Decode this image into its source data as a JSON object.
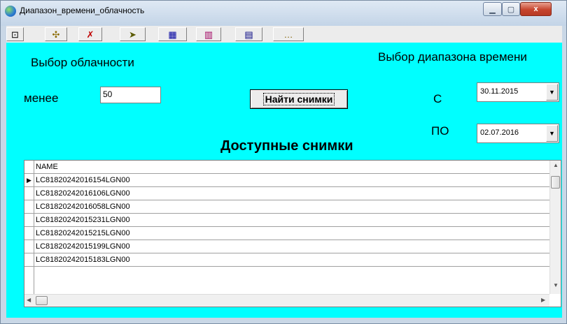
{
  "window": {
    "title": "Диапазон_времени_облачность",
    "close_glyph": "x",
    "minimize_glyph": "▁",
    "maximize_glyph": "▢"
  },
  "toolbar": {
    "buttons": [
      {
        "name": "toolbar-button-1",
        "icon": "map-grid-icon",
        "glyph": "⊡"
      },
      {
        "name": "toolbar-button-2",
        "icon": "puzzle-icon",
        "glyph": "✣"
      },
      {
        "name": "toolbar-button-3",
        "icon": "flashlight-delete-icon",
        "glyph": "✗"
      },
      {
        "name": "toolbar-button-4",
        "icon": "flashlight-forward-icon",
        "glyph": "➤"
      },
      {
        "name": "toolbar-button-5",
        "icon": "flashlight-table-icon",
        "glyph": "▦"
      },
      {
        "name": "toolbar-button-6",
        "icon": "table-edit-icon",
        "glyph": "▥"
      },
      {
        "name": "toolbar-button-7",
        "icon": "flashlight-grid-icon",
        "glyph": "▤"
      },
      {
        "name": "toolbar-button-8",
        "icon": "flashlight-more-icon",
        "glyph": "…"
      }
    ]
  },
  "form": {
    "cloud_title": "Выбор облачности",
    "time_title": "Выбор диапазона времени",
    "less_label": "менее",
    "less_value": "50",
    "find_button": "Найти снимки",
    "from_label": "С",
    "from_date": "30.11.2015",
    "to_label": "ПО",
    "to_date": "02.07.2016",
    "available_title": "Доступные снимки"
  },
  "grid": {
    "column": "NAME",
    "rows": [
      "LC81820242016154LGN00",
      "LC81820242016106LGN00",
      "LC81820242016058LGN00",
      "LC81820242015231LGN00",
      "LC81820242015215LGN00",
      "LC81820242015199LGN00",
      "LC81820242015183LGN00"
    ],
    "current_row_marker": "▶"
  },
  "colors": {
    "client_background": "#00ffff",
    "window_frame": "#c9d7e6",
    "close_button": "#c6452e"
  }
}
